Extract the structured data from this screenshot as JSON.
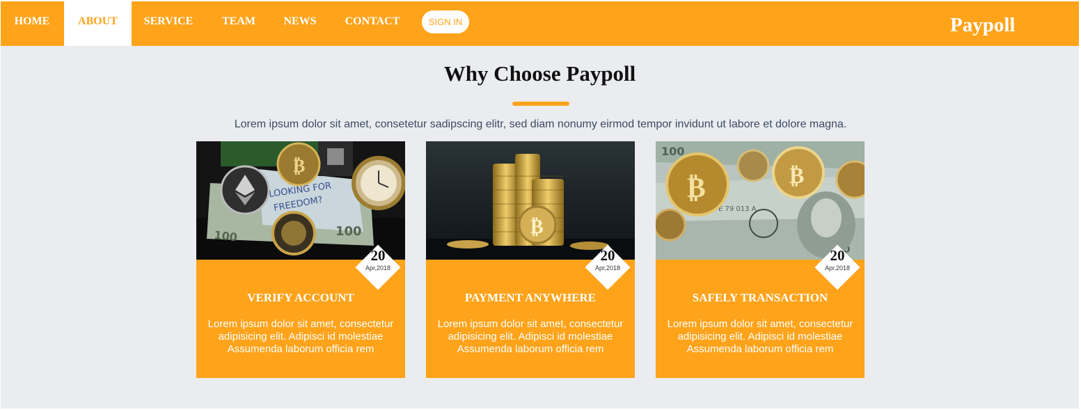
{
  "nav": {
    "items": [
      {
        "label": "HOME"
      },
      {
        "label": "ABOUT"
      },
      {
        "label": "SERVICE"
      },
      {
        "label": "TEAM"
      },
      {
        "label": "NEWS"
      },
      {
        "label": "CONTACT"
      }
    ],
    "active": "ABOUT",
    "signin_label": "SIGN IN",
    "brand": "Paypoll"
  },
  "section": {
    "title": "Why Choose Paypoll",
    "description": "Lorem ipsum dolor sit amet, consetetur sadipscing elitr, sed diam nonumy eirmod tempor invidunt ut labore et dolore magna."
  },
  "cards": [
    {
      "image": "crypto-coins-and-dollar-note",
      "day": "20",
      "month": "Apr,2018",
      "title": "VERIFY ACCOUNT",
      "text": "Lorem ipsum dolor sit amet, consectetur adipisicing elit. Adipisci id molestiae Assumenda laborum officia rem"
    },
    {
      "image": "stacked-gold-bitcoins",
      "day": "20",
      "month": "Apr,2018",
      "title": "PAYMENT ANYWHERE",
      "text": "Lorem ipsum dolor sit amet, consectetur adipisicing elit. Adipisci id molestiae Assumenda laborum officia rem"
    },
    {
      "image": "bitcoins-on-hundred-dollar-bills",
      "day": "20",
      "month": "Apr,2018",
      "title": "SAFELY TRANSACTION",
      "text": "Lorem ipsum dolor sit amet, consectetur adipisicing elit. Adipisci id molestiae Assumenda laborum officia rem"
    }
  ],
  "colors": {
    "accent": "#ffa31a",
    "background": "#eaecef",
    "text_dark": "#111111",
    "text_muted": "#3b4a63"
  }
}
